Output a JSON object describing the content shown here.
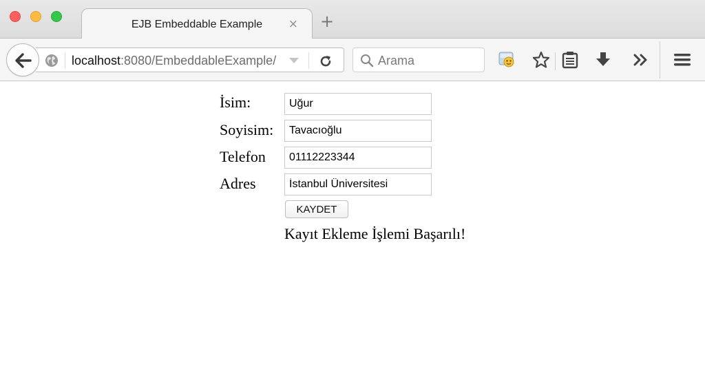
{
  "window": {
    "controls": [
      "close",
      "minimize",
      "maximize"
    ]
  },
  "tab": {
    "title": "EJB Embeddable Example",
    "close_glyph": "×",
    "new_tab_glyph": "+"
  },
  "navbar": {
    "url_host": "localhost",
    "url_rest": ":8080/EmbeddableExample/",
    "search_placeholder": "Arama",
    "icons": [
      "back-arrow-icon",
      "globe-icon",
      "dropdown-arrow-icon",
      "reload-icon",
      "search-icon",
      "extension-icon",
      "bookmark-star-icon",
      "reading-list-icon",
      "download-icon",
      "overflow-chevron-icon",
      "hamburger-menu-icon"
    ]
  },
  "form": {
    "name_label": "İsim:",
    "name_value": "Uğur",
    "surname_label": "Soyisim:",
    "surname_value": "Tavacıoğlu",
    "phone_label": "Telefon",
    "phone_value": "01112223344",
    "address_label": "Adres",
    "address_value": "İstanbul Üniversitesi",
    "submit_label": "KAYDET",
    "result_message": "Kayıt Ekleme İşlemi Başarılı!"
  }
}
